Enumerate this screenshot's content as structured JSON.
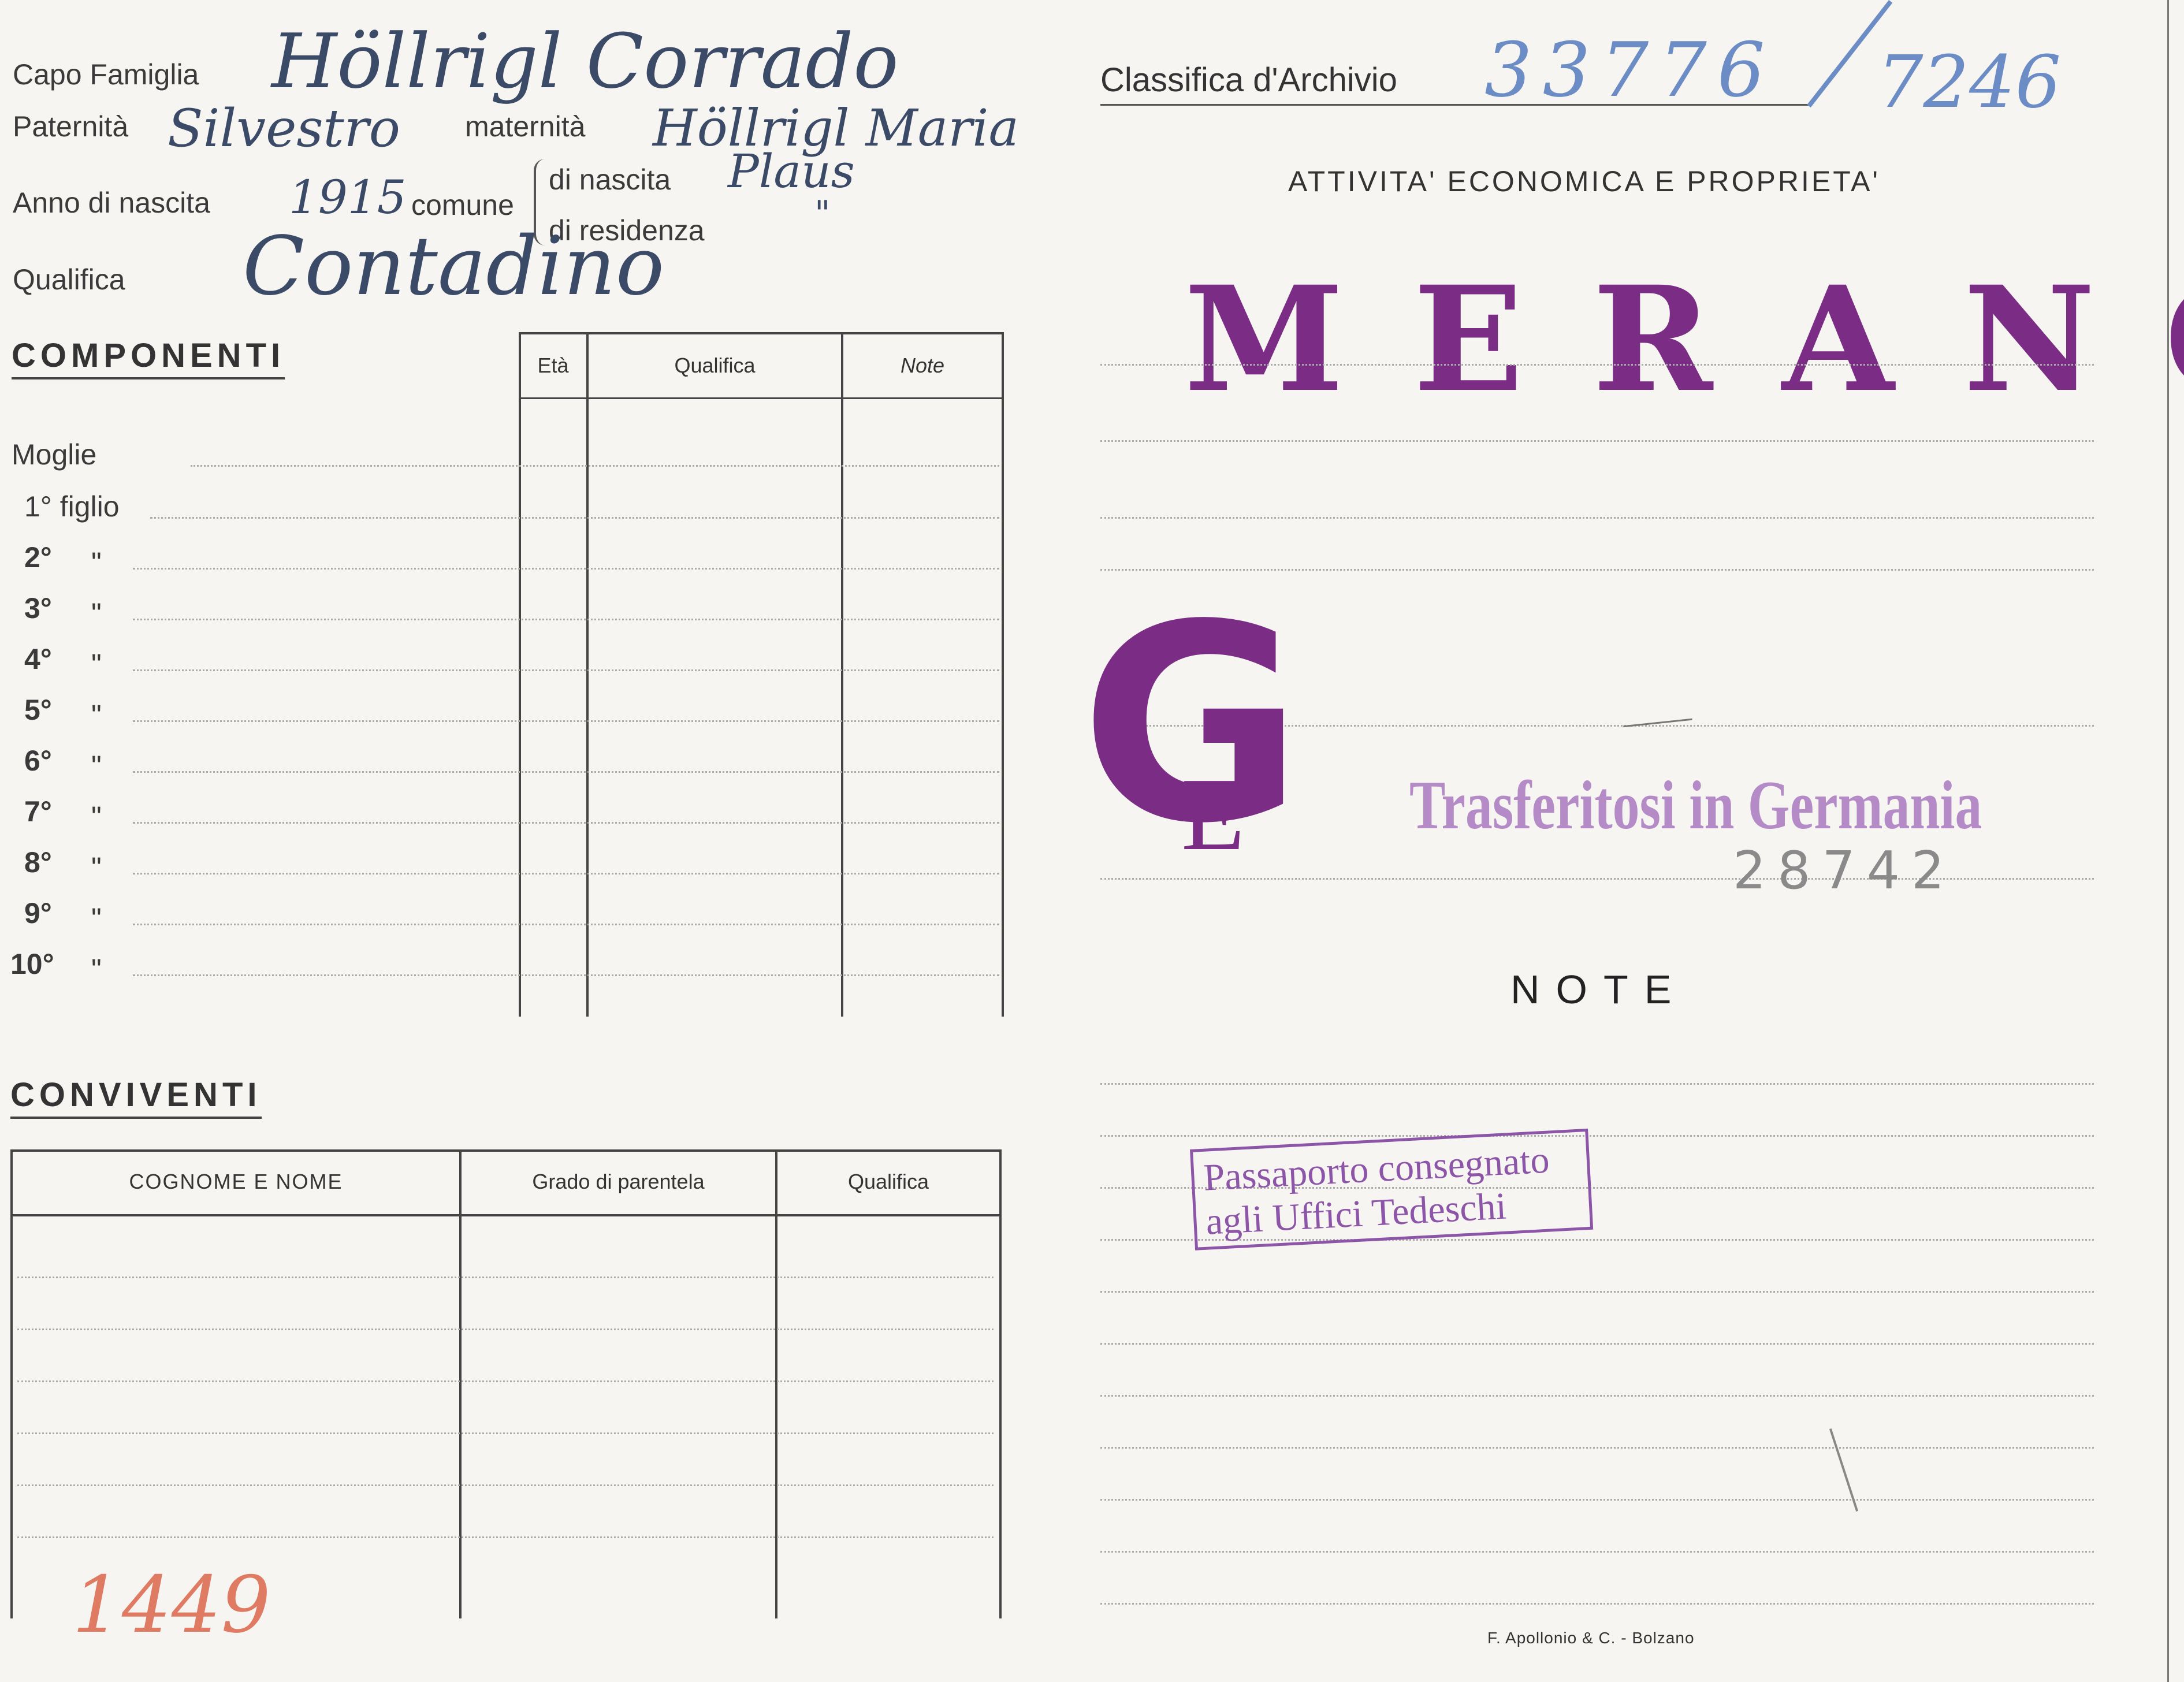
{
  "header": {
    "capo_famiglia_label": "Capo Famiglia",
    "capo_famiglia_value": "Höllrigl Corrado",
    "paternita_label": "Paternità",
    "paternita_value": "Silvestro",
    "maternita_label": "maternità",
    "maternita_value": "Höllrigl Maria",
    "anno_label": "Anno di nascita",
    "anno_value": "1915",
    "comune_label": "comune",
    "nascita_label": "di nascita",
    "nascita_value": "Plaus",
    "residenza_label": "di residenza",
    "residenza_value": "\"",
    "qualifica_label": "Qualifica",
    "qualifica_value": "Contadino",
    "classifica_label": "Classifica d'Archivio",
    "classifica_value": "33776",
    "classifica_extra": "7246"
  },
  "componenti": {
    "title": "COMPONENTI",
    "columns": [
      "Età",
      "Qualifica",
      "Note"
    ],
    "rows": [
      {
        "label": "Moglie",
        "suffix": ""
      },
      {
        "label": "1° figlio",
        "suffix": ""
      },
      {
        "label": "2°",
        "suffix": "\""
      },
      {
        "label": "3°",
        "suffix": "\""
      },
      {
        "label": "4°",
        "suffix": "\""
      },
      {
        "label": "5°",
        "suffix": "\""
      },
      {
        "label": "6°",
        "suffix": "\""
      },
      {
        "label": "7°",
        "suffix": "\""
      },
      {
        "label": "8°",
        "suffix": "\""
      },
      {
        "label": "9°",
        "suffix": "\""
      },
      {
        "label": "10°",
        "suffix": "\""
      }
    ]
  },
  "conviventi": {
    "title": "CONVIVENTI",
    "columns": [
      "COGNOME E NOME",
      "Grado di parentela",
      "Qualifica"
    ]
  },
  "right": {
    "attivita_title": "ATTIVITA' ECONOMICA E PROPRIETA'",
    "merano_stamp": "MERANO",
    "ge_stamp_g": "G",
    "ge_stamp_e": "E",
    "trasferiti_stamp": "Trasferitosi in Germania",
    "trasferiti_number": "28742",
    "note_title": "NOTE",
    "passaporto_line1": "Passaporto consegnato",
    "passaporto_line2": "agli Uffici Tedeschi",
    "printer": "F. Apollonio & C. - Bolzano"
  },
  "footer": {
    "red_number": "1449"
  },
  "colors": {
    "stamp_purple": "#7b2d85",
    "stamp_light_purple": "#b48bc6",
    "ink_blue": "#6b8cc4",
    "ink_dark": "#3b4a66",
    "red_pencil": "#e07b63"
  }
}
